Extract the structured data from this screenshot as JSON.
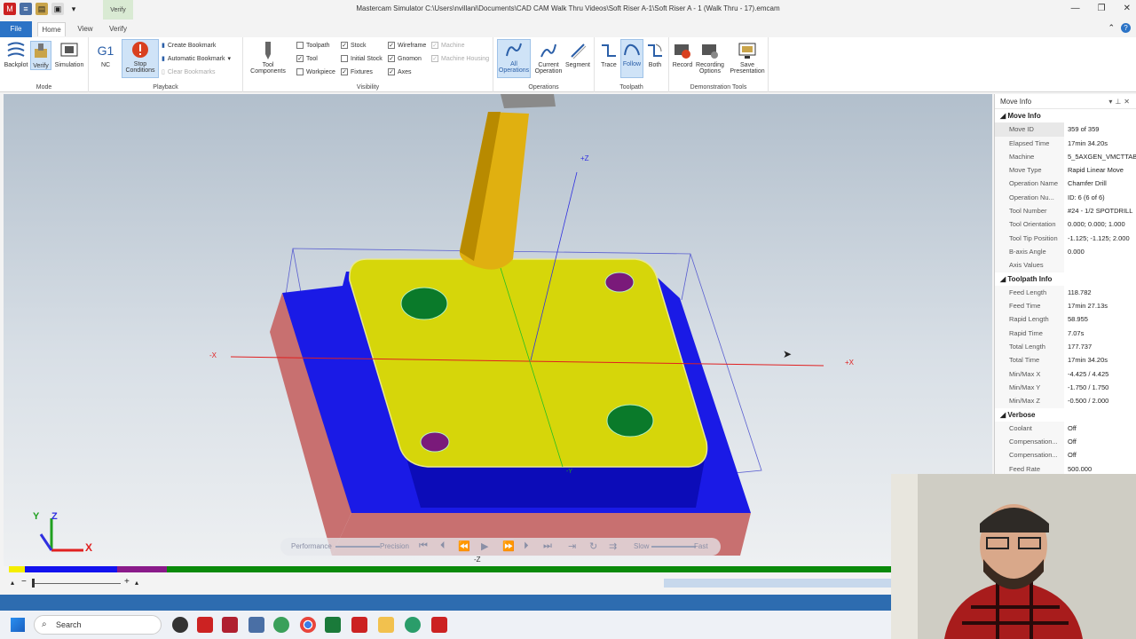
{
  "app": {
    "title": "Mastercam Simulator  C:\\Users\\nvillani\\Documents\\CAD CAM Walk Thru Videos\\Soft Riser A-1\\Soft Riser A - 1 (Walk Thru - 17).emcam",
    "window_controls": [
      "—",
      "❐",
      "✕"
    ]
  },
  "tabs": {
    "file": "File",
    "home": "Home",
    "view": "View",
    "verify": "Verify",
    "contextual_label": "Verify"
  },
  "ribbon": {
    "mode": {
      "label": "Mode",
      "backplot": "Backplot",
      "verify": "Verify",
      "simulation": "Simulation"
    },
    "playback": {
      "label": "Playback",
      "nc": "NC",
      "nc_icon_text": "G1",
      "stop_conditions": "Stop Conditions",
      "create_bookmark": "Create Bookmark",
      "automatic_bookmark": "Automatic Bookmark",
      "clear_bookmarks": "Clear Bookmarks"
    },
    "visibility": {
      "label": "Visibility",
      "tool_components": "Tool Components",
      "toolpath": "Toolpath",
      "tool": "Tool",
      "workpiece": "Workpiece",
      "stock": "Stock",
      "initial_stock": "Initial Stock",
      "fixtures": "Fixtures",
      "wireframe": "Wireframe",
      "gnomon": "Gnomon",
      "axes": "Axes",
      "machine": "Machine",
      "machine_housing": "Machine Housing"
    },
    "operations": {
      "label": "Operations",
      "all": "All Operations",
      "current": "Current Operation",
      "segment": "Segment"
    },
    "toolpath": {
      "label": "Toolpath",
      "trace": "Trace",
      "follow": "Follow",
      "both": "Both"
    },
    "demo": {
      "label": "Demonstration Tools",
      "record": "Record",
      "recording_options": "Recording Options",
      "save_presentation": "Save Presentation"
    }
  },
  "viewport": {
    "axis_labels": {
      "plus_z": "+Z",
      "minus_z": "-Z",
      "plus_x": "+X",
      "minus_x": "-X",
      "minus_y": "-Y"
    },
    "gnomon": {
      "x": "X",
      "y": "Y",
      "z": "Z"
    },
    "playbar": {
      "performance": "Performance",
      "precision": "Precision",
      "slow": "Slow",
      "fast": "Fast"
    }
  },
  "move_info": {
    "title": "Move Info",
    "sections": {
      "move": "Move Info",
      "toolpath": "Toolpath Info",
      "verbose": "Verbose"
    },
    "move_rows": [
      {
        "k": "Move ID",
        "v": "359 of 359"
      },
      {
        "k": "Elapsed Time",
        "v": "17min 34.20s"
      },
      {
        "k": "Machine",
        "v": "5_5AXGEN_VMCTTAB"
      },
      {
        "k": "Move Type",
        "v": "Rapid Linear Move"
      },
      {
        "k": "Operation Name",
        "v": "Chamfer Drill"
      },
      {
        "k": "Operation Nu...",
        "v": "ID: 6 (6 of 6)"
      },
      {
        "k": "Tool Number",
        "v": "#24 - 1/2 SPOTDRILL"
      },
      {
        "k": "Tool Orientation",
        "v": "0.000; 0.000; 1.000"
      },
      {
        "k": "Tool Tip Position",
        "v": "-1.125; -1.125; 2.000"
      },
      {
        "k": "B-axis Angle",
        "v": "0.000"
      },
      {
        "k": "Axis Values",
        "v": ""
      }
    ],
    "toolpath_rows": [
      {
        "k": "Feed Length",
        "v": "118.782"
      },
      {
        "k": "Feed Time",
        "v": "17min 27.13s"
      },
      {
        "k": "Rapid Length",
        "v": "58.955"
      },
      {
        "k": "Rapid Time",
        "v": "7.07s"
      },
      {
        "k": "Total Length",
        "v": "177.737"
      },
      {
        "k": "Total Time",
        "v": "17min 34.20s"
      },
      {
        "k": "Min/Max X",
        "v": "-4.425 / 4.425"
      },
      {
        "k": "Min/Max Y",
        "v": "-1.750 / 1.750"
      },
      {
        "k": "Min/Max Z",
        "v": "-0.500 / 2.000"
      }
    ],
    "verbose_rows": [
      {
        "k": "Coolant",
        "v": "Off"
      },
      {
        "k": "Compensation...",
        "v": "Off"
      },
      {
        "k": "Compensation...",
        "v": "Off"
      },
      {
        "k": "Feed Rate",
        "v": "500.000"
      }
    ]
  },
  "taskbar": {
    "search_placeholder": "Search"
  },
  "colors": {
    "accent": "#2b73c6",
    "stock_blue": "#1a1ae6",
    "stock_red": "#c87070",
    "top_yellow": "#d6d60a",
    "timeline": [
      "#f5ee00",
      "#1212ee",
      "#8a1a8a",
      "#0a8a0a"
    ]
  }
}
